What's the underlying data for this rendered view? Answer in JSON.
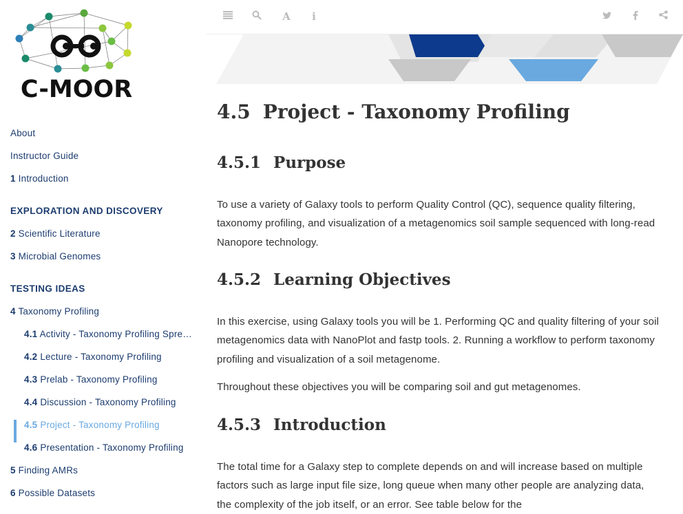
{
  "logo": {
    "text": "C-MOOR"
  },
  "toc": {
    "items": [
      {
        "num": "",
        "label": "About",
        "type": "item"
      },
      {
        "num": "",
        "label": "Instructor Guide",
        "type": "item"
      },
      {
        "num": "1",
        "label": "Introduction",
        "type": "item"
      },
      {
        "num": "",
        "label": "EXPLORATION AND DISCOVERY",
        "type": "part"
      },
      {
        "num": "2",
        "label": "Scientific Literature",
        "type": "item"
      },
      {
        "num": "3",
        "label": "Microbial Genomes",
        "type": "item"
      },
      {
        "num": "",
        "label": "TESTING IDEAS",
        "type": "part"
      },
      {
        "num": "4",
        "label": "Taxonomy Profiling",
        "type": "item"
      },
      {
        "num": "4.1",
        "label": "Activity - Taxonomy Profiling Spreadsheet",
        "type": "sub"
      },
      {
        "num": "4.2",
        "label": "Lecture - Taxonomy Profiling",
        "type": "sub"
      },
      {
        "num": "4.3",
        "label": "Prelab - Taxonomy Profiling",
        "type": "sub"
      },
      {
        "num": "4.4",
        "label": "Discussion - Taxonomy Profiling",
        "type": "sub"
      },
      {
        "num": "4.5",
        "label": "Project - Taxonomy Profiling",
        "type": "sub",
        "active": true
      },
      {
        "num": "4.6",
        "label": "Presentation - Taxonomy Profiling",
        "type": "sub"
      },
      {
        "num": "5",
        "label": "Finding AMRs",
        "type": "item"
      },
      {
        "num": "6",
        "label": "Possible Datasets",
        "type": "item"
      }
    ]
  },
  "toolbar": {
    "left_icons": [
      "menu-icon",
      "search-icon",
      "font-icon",
      "info-icon"
    ],
    "right_icons": [
      "twitter-icon",
      "facebook-icon",
      "share-icon"
    ]
  },
  "content": {
    "title_num": "4.5",
    "title": "Project - Taxonomy Profiling",
    "sections": [
      {
        "num": "4.5.1",
        "title": "Purpose"
      },
      {
        "num": "4.5.2",
        "title": "Learning Objectives"
      },
      {
        "num": "4.5.3",
        "title": "Introduction"
      }
    ],
    "purpose_text": "To use a variety of Galaxy tools to perform Quality Control (QC), sequence quality filtering, taxonomy profiling, and visualization of a metagenomics soil sample sequenced with long-read Nanopore technology.",
    "objectives_text": "In this exercise, using Galaxy tools you will be 1. Performing QC and quality filtering of your soil metagenomics data with NanoPlot and fastp tools. 2. Running a workflow to perform taxonomy profiling and visualization of a soil metagenome.",
    "objectives_text2": "Throughout these objectives you will be comparing soil and gut metagenomes.",
    "intro_text": "The total time for a Galaxy step to complete depends on and will increase based on multiple factors such as large input file size, long queue when many other people are analyzing data, the complexity of the job itself, or an error. See table below for the"
  },
  "colors": {
    "link": "#1c3c6f",
    "active": "#6aa9e0",
    "heading": "#333333"
  }
}
